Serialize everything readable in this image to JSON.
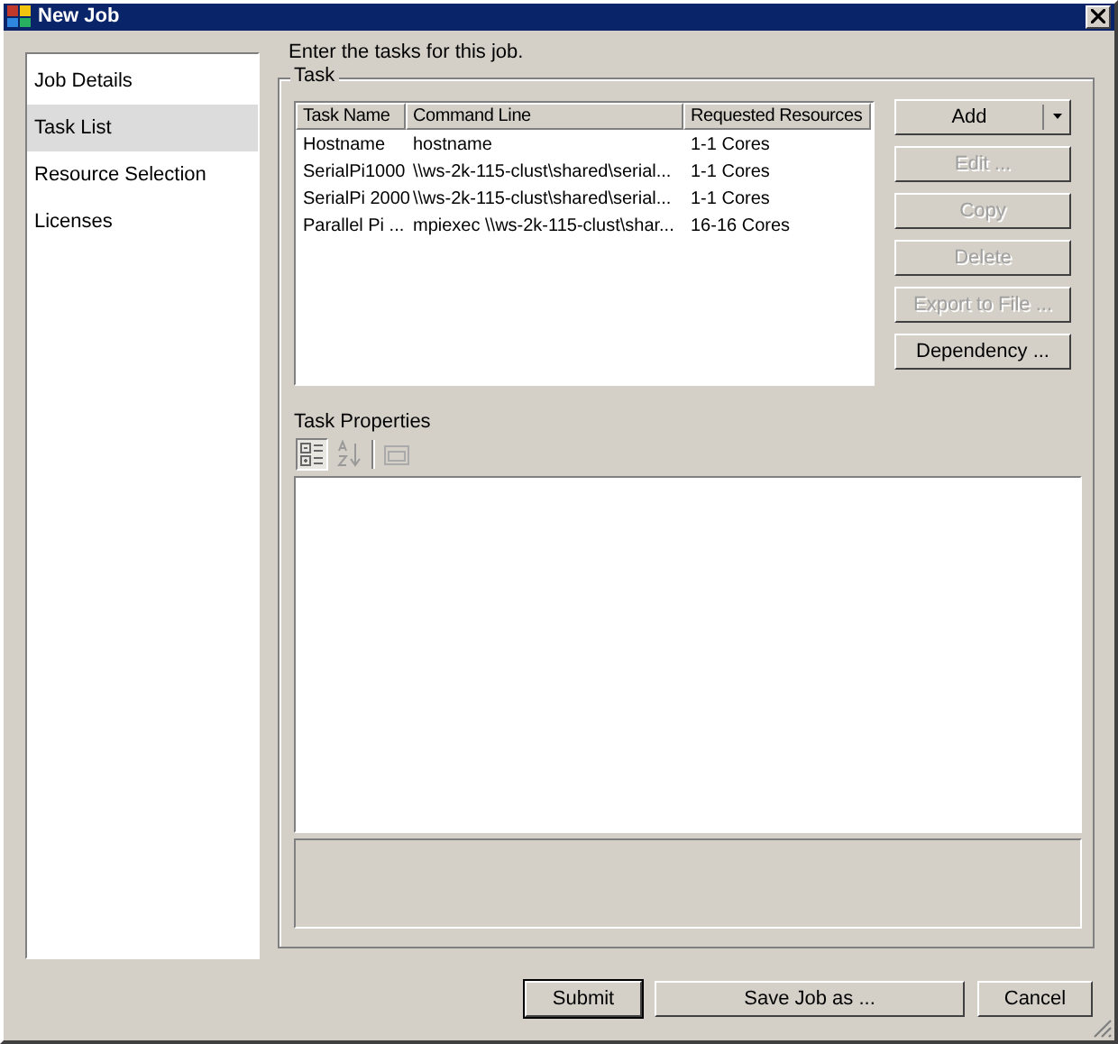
{
  "window": {
    "title": "New Job"
  },
  "sidebar": {
    "items": [
      {
        "label": "Job Details",
        "selected": false
      },
      {
        "label": "Task List",
        "selected": true
      },
      {
        "label": "Resource Selection",
        "selected": false
      },
      {
        "label": "Licenses",
        "selected": false
      }
    ]
  },
  "instruction": "Enter the tasks for this job.",
  "task_group": {
    "title": "Task",
    "columns": [
      "Task Name",
      "Command Line",
      "Requested Resources"
    ],
    "rows": [
      [
        "Hostname",
        "hostname",
        "1-1 Cores"
      ],
      [
        "SerialPi1000",
        "\\\\ws-2k-115-clust\\shared\\serial...",
        "1-1 Cores"
      ],
      [
        "SerialPi 2000",
        "\\\\ws-2k-115-clust\\shared\\serial...",
        "1-1 Cores"
      ],
      [
        "Parallel Pi ...",
        "mpiexec \\\\ws-2k-115-clust\\shar...",
        "16-16 Cores"
      ]
    ],
    "buttons": [
      {
        "label": "Add",
        "kind": "split",
        "disabled": false
      },
      {
        "label": "Edit ...",
        "kind": "plain",
        "disabled": true
      },
      {
        "label": "Copy",
        "kind": "plain",
        "disabled": true
      },
      {
        "label": "Delete",
        "kind": "plain",
        "disabled": true
      },
      {
        "label": "Export to File ...",
        "kind": "plain",
        "disabled": true
      },
      {
        "label": "Dependency ...",
        "kind": "plain",
        "disabled": false
      }
    ],
    "properties_label": "Task Properties"
  },
  "footer": {
    "buttons": [
      {
        "label": "Submit",
        "default": true
      },
      {
        "label": "Save Job as ...",
        "default": false
      },
      {
        "label": "Cancel",
        "default": false
      }
    ]
  }
}
